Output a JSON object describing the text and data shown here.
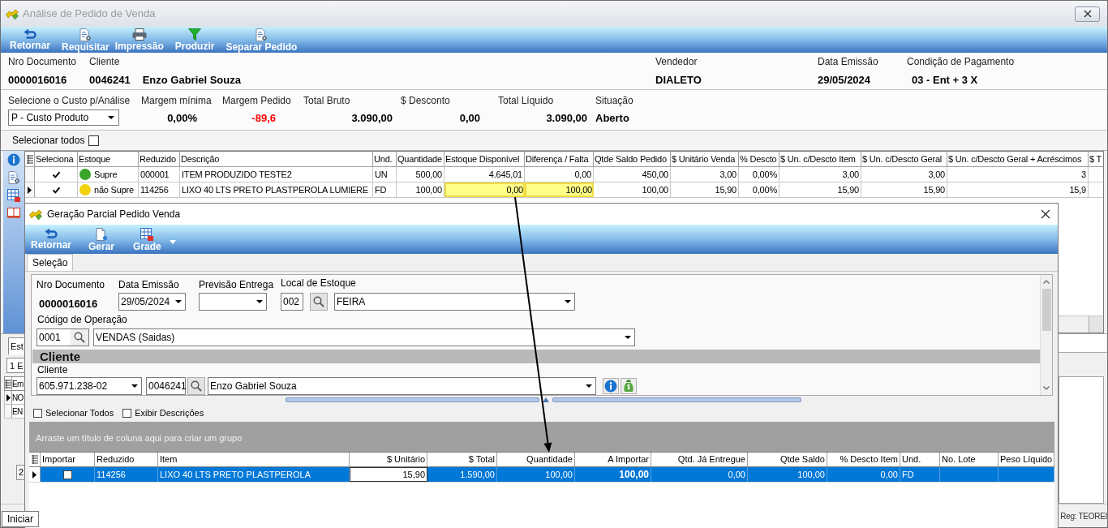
{
  "window": {
    "title": "Análise de Pedido de Venda"
  },
  "toolbar": [
    {
      "label": "Retornar"
    },
    {
      "label": "Requisitar"
    },
    {
      "label": "Impressão"
    },
    {
      "label": "Produzir"
    },
    {
      "label": "Separar Pedido"
    }
  ],
  "header": {
    "row_1": [
      {
        "label": "Nro Documento",
        "values": [
          "0000016016"
        ]
      },
      {
        "label": "Cliente",
        "values": [
          "0046241",
          "Enzo Gabriel Souza"
        ]
      },
      {
        "label": "Vendedor",
        "values": [
          "DIALETO"
        ]
      },
      {
        "label": "Data Emissão",
        "values": [
          "29/05/2024"
        ]
      },
      {
        "label": "Condição de Pagamento",
        "values": [
          "03 - Ent + 3 X"
        ]
      }
    ],
    "row_2": [
      {
        "label": "Selecione o Custo p/Análise",
        "kind": "dropdown",
        "value": "P - Custo Produto",
        "negative": false
      },
      {
        "label": "Margem mínima",
        "kind": "value",
        "value": "0,00%",
        "negative": false
      },
      {
        "label": "Margem Pedido",
        "kind": "value",
        "value": "-89,6",
        "negative": true
      },
      {
        "label": "Total Bruto",
        "kind": "value",
        "value": "3.090,00",
        "negative": false
      },
      {
        "label": "$ Desconto",
        "kind": "value",
        "value": "0,00",
        "negative": false
      },
      {
        "label": "Total Líquido",
        "kind": "value",
        "value": "3.090,00",
        "negative": false
      },
      {
        "label": "Situação",
        "kind": "value",
        "value": "Aberto",
        "negative": false
      }
    ]
  },
  "select_all": {
    "label": "Selecionar todos",
    "checked": false
  },
  "grid": {
    "columns": [
      "Seleciona",
      "Estoque",
      "Reduzido",
      "Descrição",
      "Und.",
      "Quantidade",
      "Estoque Disponível",
      "Diferença / Falta",
      "Qtde Saldo Pedido",
      "$ Unitário Venda",
      "% Descto",
      "$ Un. c/Descto Item",
      "$ Un. c/Descto Geral",
      "$ Un. c/Descto Geral + Acréscimos",
      "$ T"
    ],
    "rows": [
      {
        "selected": false,
        "cells": [
          {
            "kind": "checkbox",
            "checked": true
          },
          {
            "kind": "status",
            "text": "Supre",
            "color": "#3aa52a"
          },
          {
            "kind": "text",
            "text": "000001",
            "highlighted": false
          },
          {
            "kind": "text",
            "text": "ITEM PRODUZIDO TESTE2",
            "highlighted": false
          },
          {
            "kind": "text",
            "text": "UN",
            "highlighted": false
          },
          {
            "kind": "text",
            "text": "500,00",
            "highlighted": false
          },
          {
            "kind": "text",
            "text": "4.645,01",
            "highlighted": false
          },
          {
            "kind": "text",
            "text": "0,00",
            "highlighted": false
          },
          {
            "kind": "text",
            "text": "450,00",
            "highlighted": false
          },
          {
            "kind": "text",
            "text": "3,00",
            "highlighted": false
          },
          {
            "kind": "text",
            "text": "0,00%",
            "highlighted": false
          },
          {
            "kind": "text",
            "text": "3,00",
            "highlighted": false
          },
          {
            "kind": "text",
            "text": "3,00",
            "highlighted": false
          },
          {
            "kind": "text",
            "text": "3",
            "highlighted": false
          }
        ]
      },
      {
        "selected": true,
        "cells": [
          {
            "kind": "checkbox",
            "checked": true
          },
          {
            "kind": "status",
            "text": "não Supre",
            "color": "#f2d20c"
          },
          {
            "kind": "text",
            "text": "114256",
            "highlighted": false
          },
          {
            "kind": "text",
            "text": "LIXO 40 LTS PRETO PLASTPEROLA LUMIERE",
            "highlighted": false
          },
          {
            "kind": "text",
            "text": "FD",
            "highlighted": false
          },
          {
            "kind": "text",
            "text": "100,00",
            "highlighted": false
          },
          {
            "kind": "text",
            "text": "0,00",
            "highlighted": true
          },
          {
            "kind": "text",
            "text": "100,00",
            "highlighted": true
          },
          {
            "kind": "text",
            "text": "100,00",
            "highlighted": false
          },
          {
            "kind": "text",
            "text": "15,90",
            "highlighted": false
          },
          {
            "kind": "text",
            "text": "0,00%",
            "highlighted": false
          },
          {
            "kind": "text",
            "text": "15,90",
            "highlighted": false
          },
          {
            "kind": "text",
            "text": "15,90",
            "highlighted": false
          },
          {
            "kind": "text",
            "text": "15,9",
            "highlighted": false
          }
        ]
      }
    ]
  },
  "lower_panel": {
    "tabs": [
      {
        "label": "Est",
        "selected": true
      }
    ],
    "sub_tabs": [
      {
        "label": "1 E",
        "selected": true
      }
    ],
    "table": {
      "columns": [
        "Em"
      ],
      "rows": [
        {
          "text": "NO",
          "selected": true
        },
        {
          "text": "EN",
          "selected": false
        }
      ]
    },
    "pager": "2"
  },
  "status_bar": {
    "text": "Reg: TEOREI"
  },
  "taskbar": {
    "start_button": "Iniciar"
  },
  "dialog": {
    "title": "Geração Parcial Pedido Venda",
    "toolbar": [
      {
        "label": "Retornar"
      },
      {
        "label": "Gerar"
      },
      {
        "label": "Grade"
      }
    ],
    "tabs": [
      {
        "label": "Seleção",
        "selected": true
      }
    ],
    "form": {
      "document": {
        "label": "Nro Documento",
        "value": "0000016016"
      },
      "issue_date": {
        "label": "Data Emissão",
        "value": "29/05/2024"
      },
      "delivery_forecast": {
        "label": "Previsão Entrega"
      },
      "stock_location": {
        "label": "Local de Estoque",
        "code": "002",
        "name": "FEIRA"
      },
      "operation": {
        "label": "Código de Operação",
        "code": "0001",
        "name": "VENDAS (Saidas)"
      },
      "section_title": "Cliente",
      "customer": {
        "label": "Cliente",
        "tax_id": "605.971.238-02",
        "code": "0046241",
        "name": "Enzo Gabriel Souza"
      }
    },
    "options": [
      {
        "label": "Selecionar Todos",
        "checked": false
      },
      {
        "label": "Exibir Descrições",
        "checked": false
      }
    ],
    "group_panel_hint": "Arraste um título de coluna aqui para criar um grupo",
    "grid": {
      "columns": [
        "Importar",
        "Reduzido",
        "Item",
        "$ Unitário",
        "$ Total",
        "Quantidade",
        "A Importar",
        "Qtd. Já Entregue",
        "Qtde Saldo",
        "% Descto Item",
        "Und.",
        "No. Lote",
        "Peso Líquido"
      ],
      "rows": [
        {
          "selected": true,
          "cells": [
            {
              "kind": "checkbox",
              "checked": false
            },
            {
              "kind": "text",
              "text": "114256",
              "focused": false,
              "bold": false
            },
            {
              "kind": "text",
              "text": "LIXO 40 LTS PRETO PLASTPEROLA",
              "focused": false,
              "bold": false
            },
            {
              "kind": "text",
              "text": "15,90",
              "focused": true,
              "bold": false
            },
            {
              "kind": "text",
              "text": "1.590,00",
              "focused": false,
              "bold": false
            },
            {
              "kind": "text",
              "text": "100,00",
              "focused": false,
              "bold": false
            },
            {
              "kind": "text",
              "text": "100,00",
              "focused": false,
              "bold": true
            },
            {
              "kind": "text",
              "text": "0,00",
              "focused": false,
              "bold": false
            },
            {
              "kind": "text",
              "text": "100,00",
              "focused": false,
              "bold": false
            },
            {
              "kind": "text",
              "text": "0,00",
              "focused": false,
              "bold": false
            },
            {
              "kind": "text",
              "text": "FD",
              "focused": false,
              "bold": false
            }
          ]
        }
      ]
    }
  }
}
